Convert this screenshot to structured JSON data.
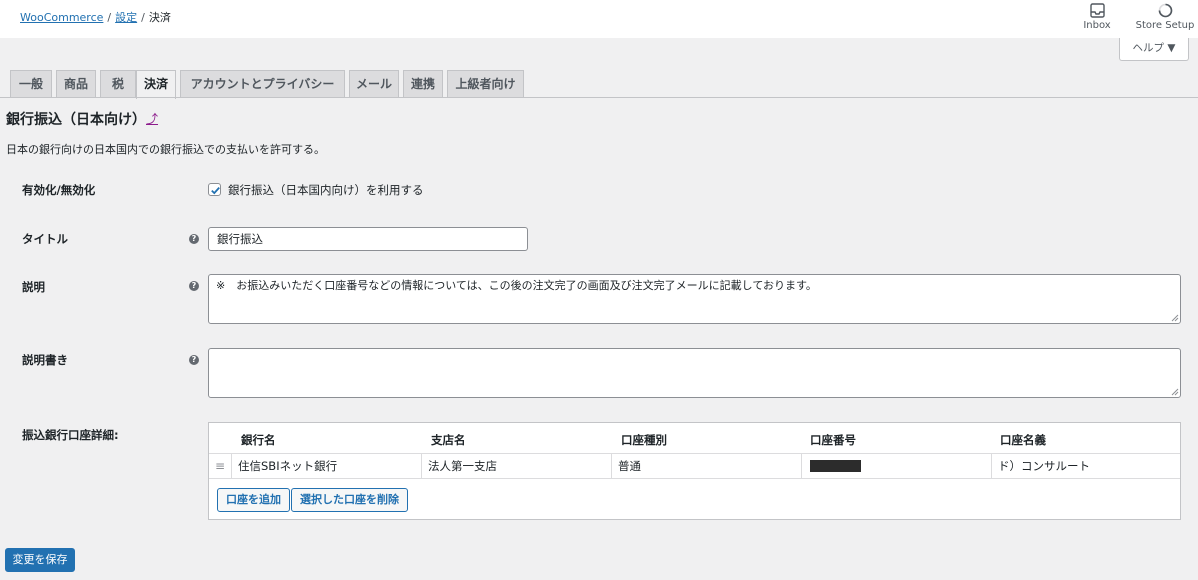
{
  "breadcrumb": {
    "items": [
      "WooCommerce",
      "設定",
      "決済"
    ],
    "separator": "/"
  },
  "header": {
    "inbox_label": "Inbox",
    "store_setup_label": "Store Setup",
    "help_label": "ヘルプ ▼"
  },
  "tabs": [
    {
      "label": "一般",
      "active": false
    },
    {
      "label": "商品",
      "active": false
    },
    {
      "label": "税",
      "active": false
    },
    {
      "label": "決済",
      "active": true
    },
    {
      "label": "アカウントとプライバシー",
      "active": false
    },
    {
      "label": "メール",
      "active": false
    },
    {
      "label": "連携",
      "active": false
    },
    {
      "label": "上級者向け",
      "active": false
    }
  ],
  "section": {
    "title": "銀行振込（日本向け）",
    "up_link": "⤴",
    "description": "日本の銀行向けの日本国内での銀行振込での支払いを許可する。"
  },
  "fields": {
    "enable": {
      "label": "有効化/無効化",
      "checkbox_label": "銀行振込（日本国内向け）を利用する",
      "checked": true
    },
    "title": {
      "label": "タイトル",
      "value": "銀行振込"
    },
    "description": {
      "label": "説明",
      "value": "※　お振込みいただく口座番号などの情報については、この後の注文完了の画面及び注文完了メールに記載しております。"
    },
    "instructions": {
      "label": "説明書き",
      "value": ""
    },
    "accounts": {
      "label": "振込銀行口座詳細:",
      "columns": [
        "銀行名",
        "支店名",
        "口座種別",
        "口座番号",
        "口座名義"
      ],
      "rows": [
        {
          "bank": "住信SBIネット銀行",
          "branch": "法人第一支店",
          "type": "普通",
          "number": "",
          "name": "ド）コンサルート"
        }
      ],
      "add_button": "口座を追加",
      "remove_button": "選択した口座を削除"
    }
  },
  "save_button": "変更を保存",
  "colors": {
    "accent": "#2271b1",
    "background": "#f0f0f1",
    "tab_inactive": "#dcdcde"
  },
  "icons": {
    "inbox": "inbox-icon",
    "store_setup": "progress-ring-icon",
    "help": "question-circle-icon",
    "drag": "drag-handle-icon"
  }
}
